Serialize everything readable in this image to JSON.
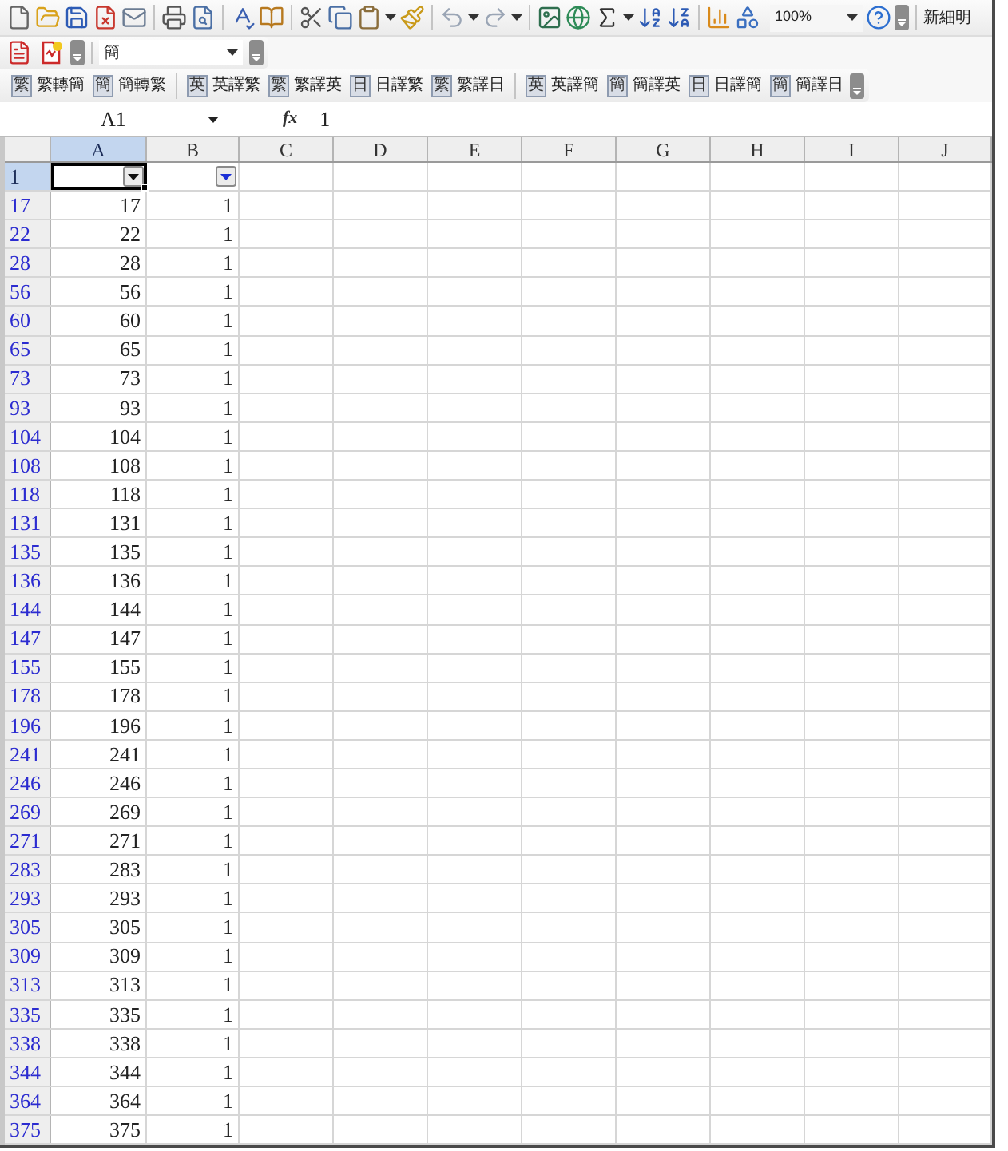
{
  "standard_toolbar": {
    "zoom": "100%",
    "font": "新細明"
  },
  "pdf_toolbar": {
    "font": "簡"
  },
  "translate_toolbar": {
    "groups": [
      [
        {
          "badge": "繁",
          "label": "繁轉簡"
        },
        {
          "badge": "簡",
          "label": "簡轉繁"
        }
      ],
      [
        {
          "badge": "英",
          "label": "英譯繁"
        },
        {
          "badge": "繁",
          "label": "繁譯英"
        },
        {
          "badge": "日",
          "label": "日譯繁"
        },
        {
          "badge": "繁",
          "label": "繁譯日"
        }
      ],
      [
        {
          "badge": "英",
          "label": "英譯簡"
        },
        {
          "badge": "簡",
          "label": "簡譯英"
        },
        {
          "badge": "日",
          "label": "日譯簡"
        },
        {
          "badge": "簡",
          "label": "簡譯日"
        }
      ]
    ]
  },
  "formula_bar": {
    "name_box": "A1",
    "function_symbol": "fx",
    "value": "1"
  },
  "sheet": {
    "columns": [
      {
        "label": "A",
        "selected": true
      },
      {
        "label": "B",
        "selected": false
      },
      {
        "label": "C",
        "selected": false
      },
      {
        "label": "D",
        "selected": false
      },
      {
        "label": "E",
        "selected": false
      },
      {
        "label": "F",
        "selected": false
      },
      {
        "label": "G",
        "selected": false
      },
      {
        "label": "H",
        "selected": false
      },
      {
        "label": "I",
        "selected": false
      },
      {
        "label": "J",
        "selected": false
      }
    ],
    "filter_row": {
      "header": "1",
      "selected": true,
      "filters": [
        {
          "selected": true,
          "active": false
        },
        {
          "selected": false,
          "active": true
        }
      ]
    },
    "rows": [
      {
        "header": "17",
        "filtered": true,
        "values": [
          "17",
          "1"
        ]
      },
      {
        "header": "22",
        "filtered": true,
        "values": [
          "22",
          "1"
        ]
      },
      {
        "header": "28",
        "filtered": true,
        "values": [
          "28",
          "1"
        ]
      },
      {
        "header": "56",
        "filtered": true,
        "values": [
          "56",
          "1"
        ]
      },
      {
        "header": "60",
        "filtered": true,
        "values": [
          "60",
          "1"
        ]
      },
      {
        "header": "65",
        "filtered": true,
        "values": [
          "65",
          "1"
        ]
      },
      {
        "header": "73",
        "filtered": true,
        "values": [
          "73",
          "1"
        ]
      },
      {
        "header": "93",
        "filtered": true,
        "values": [
          "93",
          "1"
        ]
      },
      {
        "header": "104",
        "filtered": true,
        "values": [
          "104",
          "1"
        ]
      },
      {
        "header": "108",
        "filtered": true,
        "values": [
          "108",
          "1"
        ]
      },
      {
        "header": "118",
        "filtered": true,
        "values": [
          "118",
          "1"
        ]
      },
      {
        "header": "131",
        "filtered": true,
        "values": [
          "131",
          "1"
        ]
      },
      {
        "header": "135",
        "filtered": true,
        "values": [
          "135",
          "1"
        ]
      },
      {
        "header": "136",
        "filtered": true,
        "values": [
          "136",
          "1"
        ]
      },
      {
        "header": "144",
        "filtered": true,
        "values": [
          "144",
          "1"
        ]
      },
      {
        "header": "147",
        "filtered": true,
        "values": [
          "147",
          "1"
        ]
      },
      {
        "header": "155",
        "filtered": true,
        "values": [
          "155",
          "1"
        ]
      },
      {
        "header": "178",
        "filtered": true,
        "values": [
          "178",
          "1"
        ]
      },
      {
        "header": "196",
        "filtered": true,
        "values": [
          "196",
          "1"
        ]
      },
      {
        "header": "241",
        "filtered": true,
        "values": [
          "241",
          "1"
        ]
      },
      {
        "header": "246",
        "filtered": true,
        "values": [
          "246",
          "1"
        ]
      },
      {
        "header": "269",
        "filtered": true,
        "values": [
          "269",
          "1"
        ]
      },
      {
        "header": "271",
        "filtered": true,
        "values": [
          "271",
          "1"
        ]
      },
      {
        "header": "283",
        "filtered": true,
        "values": [
          "283",
          "1"
        ]
      },
      {
        "header": "293",
        "filtered": true,
        "values": [
          "293",
          "1"
        ]
      },
      {
        "header": "305",
        "filtered": true,
        "values": [
          "305",
          "1"
        ]
      },
      {
        "header": "309",
        "filtered": true,
        "values": [
          "309",
          "1"
        ]
      },
      {
        "header": "313",
        "filtered": true,
        "values": [
          "313",
          "1"
        ]
      },
      {
        "header": "335",
        "filtered": true,
        "values": [
          "335",
          "1"
        ]
      },
      {
        "header": "338",
        "filtered": true,
        "values": [
          "338",
          "1"
        ]
      },
      {
        "header": "344",
        "filtered": true,
        "values": [
          "344",
          "1"
        ]
      },
      {
        "header": "364",
        "filtered": true,
        "values": [
          "364",
          "1"
        ]
      },
      {
        "header": "375",
        "filtered": true,
        "values": [
          "375",
          "1"
        ]
      }
    ]
  }
}
